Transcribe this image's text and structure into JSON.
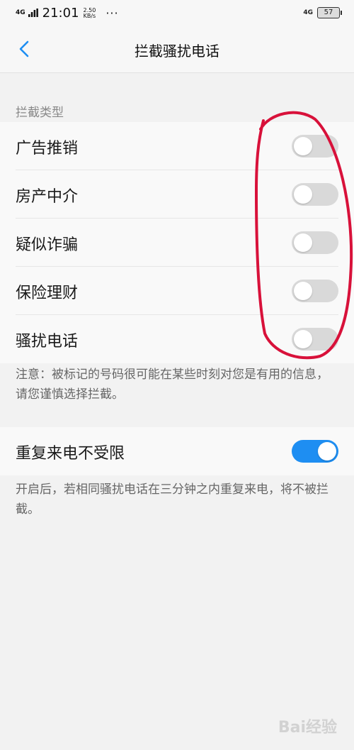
{
  "status_bar": {
    "network": "4G",
    "time": "21:01",
    "speed_value": "2.50",
    "speed_unit": "KB/s",
    "more": "···",
    "network_right": "4G",
    "battery": "57"
  },
  "header": {
    "title": "拦截骚扰电话",
    "back_icon": "chevron-left-icon"
  },
  "block_types": {
    "section_title": "拦截类型",
    "items": [
      {
        "label": "广告推销",
        "enabled": false
      },
      {
        "label": "房产中介",
        "enabled": false
      },
      {
        "label": "疑似诈骗",
        "enabled": false
      },
      {
        "label": "保险理财",
        "enabled": false
      },
      {
        "label": "骚扰电话",
        "enabled": false
      }
    ],
    "note": "注意：被标记的号码很可能在某些时刻对您是有用的信息，请您谨慎选择拦截。"
  },
  "repeat_call": {
    "label": "重复来电不受限",
    "enabled": true,
    "note": "开启后，若相同骚扰电话在三分钟之内重复来电，将不被拦截。"
  },
  "watermark": "Bai经验",
  "colors": {
    "accent": "#1e8ef2",
    "toggle_off": "#d9d9d9",
    "annotation": "#d8113a"
  }
}
